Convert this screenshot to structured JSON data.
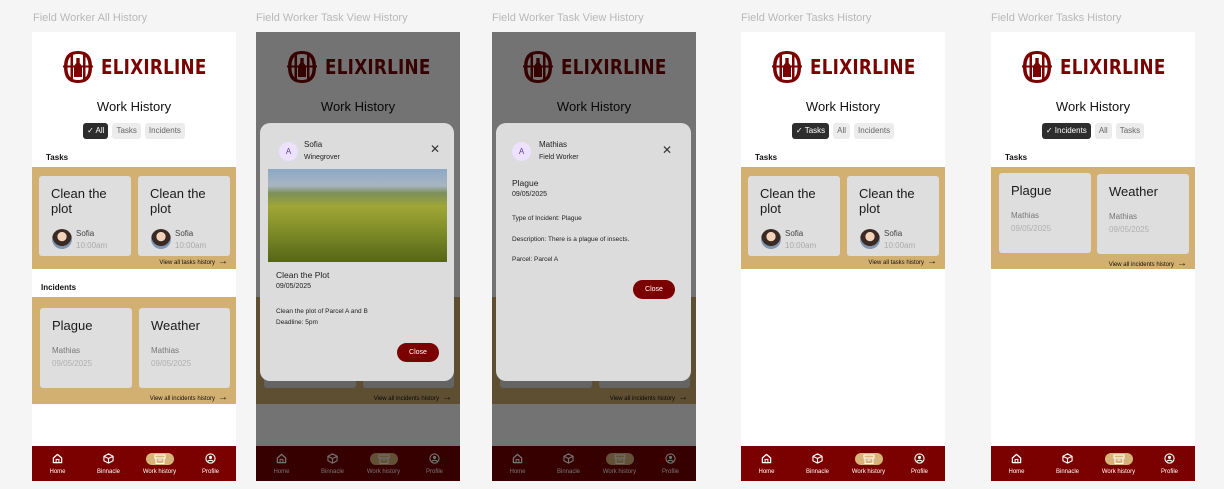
{
  "frames": [
    {
      "label": "Field Worker All History"
    },
    {
      "label": "Field Worker Task View History"
    },
    {
      "label": "Field Worker Task View History"
    },
    {
      "label": "Field Worker Tasks History"
    },
    {
      "label": "Field Worker Tasks History"
    }
  ],
  "brand": {
    "name": "ELIXIRLINE",
    "color": "#7b0000",
    "accent": "#d1b072"
  },
  "page": {
    "title": "Work History"
  },
  "filters": {
    "all_view": [
      "All",
      "Tasks",
      "Incidents"
    ],
    "tasks_view": [
      "Tasks",
      "All",
      "Incidents"
    ],
    "incidents_view": [
      "Incidents",
      "All",
      "Tasks"
    ]
  },
  "sections": {
    "tasks": "Tasks",
    "incidents": "Incidents"
  },
  "tasks": [
    {
      "title": "Clean the plot",
      "name": "Sofia",
      "time": "10:00am"
    },
    {
      "title": "Clean the plot",
      "name": "Sofia",
      "time": "10:00am"
    }
  ],
  "incidents": [
    {
      "title": "Plague",
      "name": "Mathias",
      "date": "09/05/2025"
    },
    {
      "title": "Weather",
      "name": "Mathias",
      "date": "09/05/2025"
    }
  ],
  "links": {
    "all_tasks": "View all tasks history",
    "all_incidents": "View all incidents history"
  },
  "nav": [
    {
      "label": "Home",
      "icon": "home-icon"
    },
    {
      "label": "Binnacle",
      "icon": "box-icon"
    },
    {
      "label": "Work history",
      "icon": "archive-icon"
    },
    {
      "label": "Profile",
      "icon": "profile-icon"
    }
  ],
  "task_modal": {
    "avatar": "A",
    "name": "Sofia",
    "role": "Winegrover",
    "task_title": "Clean the Plot",
    "date": "09/05/2025",
    "description": "Clean the plot of Parcel A and B",
    "deadline": "Deadline: 5pm",
    "close": "Close"
  },
  "incident_modal": {
    "avatar": "A",
    "name": "Mathias",
    "role": "Field Worker",
    "incident_title": "Plague",
    "date": "09/05/2025",
    "type": "Type of Incident: Plague",
    "description": "Description: There is a plague of insects.",
    "parcel": "Parcel: Parcel A",
    "close": "Close"
  }
}
